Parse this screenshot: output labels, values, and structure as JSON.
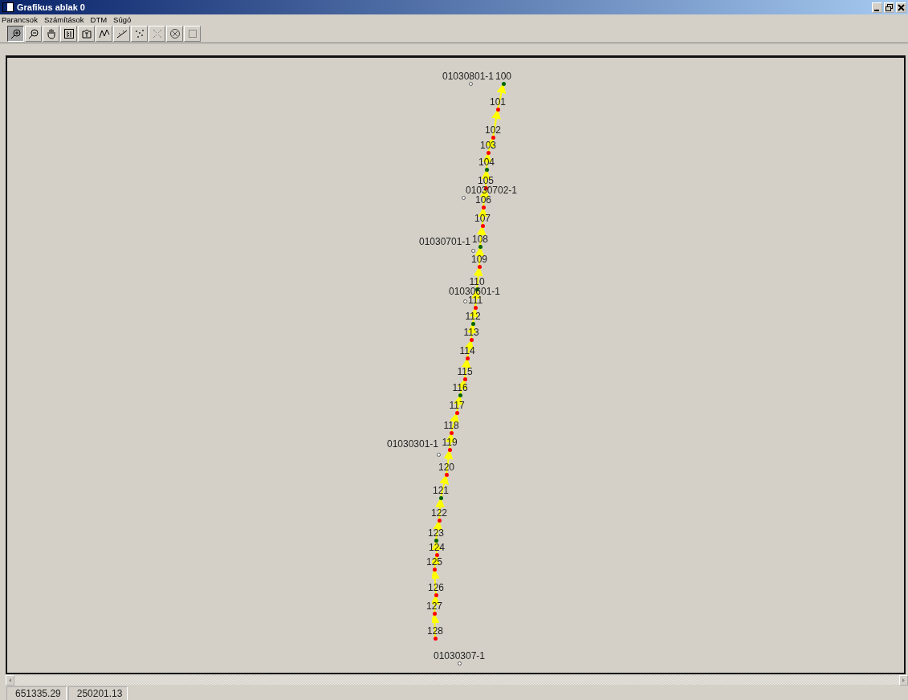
{
  "window": {
    "title": "Grafikus ablak 0"
  },
  "menu": [
    "Parancsok",
    "Számítások",
    "DTM",
    "Súgó"
  ],
  "toolbar": [
    {
      "kind": "zoom-in",
      "selected": true
    },
    {
      "kind": "zoom-out",
      "selected": false
    },
    {
      "kind": "pan",
      "selected": false
    },
    {
      "kind": "scale",
      "selected": false
    },
    {
      "kind": "text",
      "selected": false
    },
    {
      "kind": "curve",
      "selected": false
    },
    {
      "kind": "line",
      "selected": false
    },
    {
      "kind": "dots",
      "selected": false
    },
    {
      "kind": "cross",
      "selected": false
    },
    {
      "kind": "erase",
      "selected": false
    },
    {
      "kind": "frame",
      "selected": false
    }
  ],
  "points": [
    {
      "label": "01030801-1",
      "kind": "control"
    },
    {
      "label": "100",
      "kind": "station",
      "color": "#006400"
    },
    {
      "label": "101",
      "kind": "station",
      "color": "#ff0000"
    },
    {
      "label": "102",
      "kind": "station",
      "color": "#ff0000"
    },
    {
      "label": "103",
      "kind": "station",
      "color": "#ff0000"
    },
    {
      "label": "104",
      "kind": "station",
      "color": "#006400"
    },
    {
      "label": "105",
      "kind": "station",
      "color": "#ff0000"
    },
    {
      "label": "01030702-1",
      "kind": "control"
    },
    {
      "label": "106",
      "kind": "station",
      "color": "#ff0000"
    },
    {
      "label": "107",
      "kind": "station",
      "color": "#ff0000"
    },
    {
      "label": "108",
      "kind": "station",
      "color": "#006400"
    },
    {
      "label": "01030701-1",
      "kind": "control"
    },
    {
      "label": "109",
      "kind": "station",
      "color": "#ff0000"
    },
    {
      "label": "110",
      "kind": "station",
      "color": "#006400"
    },
    {
      "label": "01030601-1",
      "kind": "control"
    },
    {
      "label": "111",
      "kind": "station",
      "color": "#ff0000"
    },
    {
      "label": "112",
      "kind": "station",
      "color": "#006400"
    },
    {
      "label": "113",
      "kind": "station",
      "color": "#ff0000"
    },
    {
      "label": "114",
      "kind": "station",
      "color": "#ff0000"
    },
    {
      "label": "115",
      "kind": "station",
      "color": "#ff0000"
    },
    {
      "label": "116",
      "kind": "station",
      "color": "#006400"
    },
    {
      "label": "117",
      "kind": "station",
      "color": "#ff0000"
    },
    {
      "label": "118",
      "kind": "station",
      "color": "#ff0000"
    },
    {
      "label": "119",
      "kind": "station",
      "color": "#ff0000"
    },
    {
      "label": "01030301-1",
      "kind": "control"
    },
    {
      "label": "120",
      "kind": "station",
      "color": "#ff0000"
    },
    {
      "label": "121",
      "kind": "station",
      "color": "#006400"
    },
    {
      "label": "122",
      "kind": "station",
      "color": "#ff0000"
    },
    {
      "label": "123",
      "kind": "station",
      "color": "#006400"
    },
    {
      "label": "124",
      "kind": "station",
      "color": "#ff0000"
    },
    {
      "label": "125",
      "kind": "station",
      "color": "#ff0000"
    },
    {
      "label": "126",
      "kind": "station",
      "color": "#ff0000"
    },
    {
      "label": "127",
      "kind": "station",
      "color": "#ff0000"
    },
    {
      "label": "128",
      "kind": "station",
      "color": "#ff0000"
    },
    {
      "label": "01030307-1",
      "kind": "control"
    }
  ],
  "status_bar": [
    "651335.29",
    "250201.13"
  ]
}
